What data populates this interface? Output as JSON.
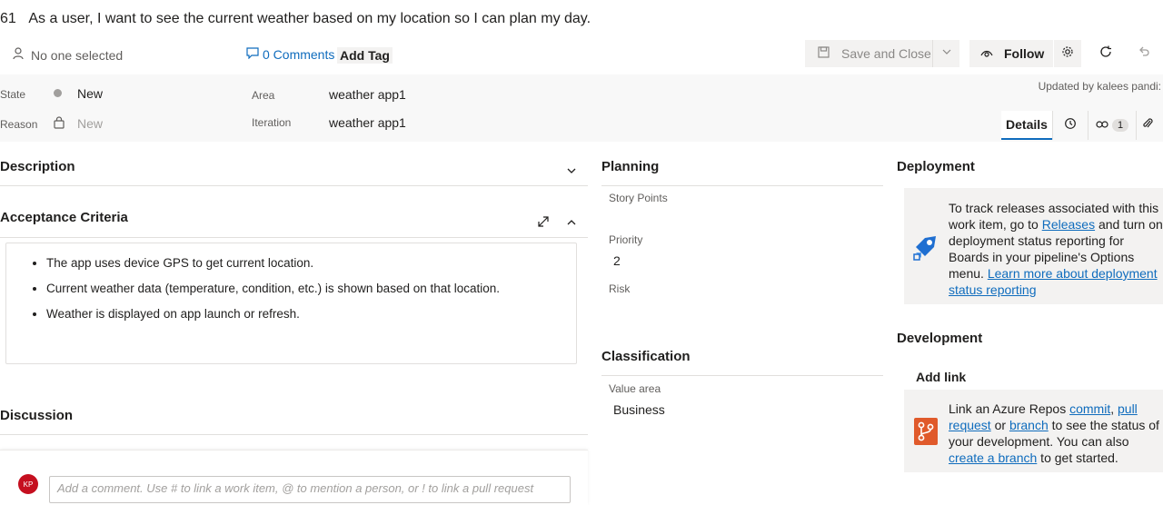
{
  "work_item": {
    "id": "61",
    "title": "As a user, I want to see the current weather based on my location so I can plan my day."
  },
  "toolbar": {
    "assignee": "No one selected",
    "comments_label": "0 Comments",
    "add_tag_label": "Add Tag",
    "save_label": "Save and Close",
    "follow_label": "Follow"
  },
  "fields": {
    "state_label": "State",
    "state_value": "New",
    "reason_label": "Reason",
    "reason_value": "New",
    "area_label": "Area",
    "area_value": "weather app1",
    "iteration_label": "Iteration",
    "iteration_value": "weather app1"
  },
  "updated_by": "Updated by kalees pandi:",
  "tabs": {
    "details_label": "Details",
    "links_count": "1"
  },
  "description": {
    "title": "Description"
  },
  "acceptance": {
    "title": "Acceptance Criteria",
    "items": [
      "The app uses device GPS to get current location.",
      "Current weather data (temperature, condition, etc.) is shown based on that location.",
      "Weather is displayed on app launch or refresh."
    ]
  },
  "discussion": {
    "title": "Discussion",
    "avatar_initials": "KP",
    "placeholder": "Add a comment. Use # to link a work item, @ to mention a person, or ! to link a pull request"
  },
  "planning": {
    "title": "Planning",
    "story_points_label": "Story Points",
    "priority_label": "Priority",
    "priority_value": "2",
    "risk_label": "Risk"
  },
  "classification": {
    "title": "Classification",
    "value_area_label": "Value area",
    "value_area_value": "Business"
  },
  "deployment": {
    "title": "Deployment",
    "text_1": "To track releases associated with this work item, go to ",
    "link_releases": "Releases",
    "text_2": " and turn on deployment status reporting for Boards in your pipeline's Options menu. ",
    "link_learn": "Learn more about deployment status reporting"
  },
  "development": {
    "title": "Development",
    "add_link_label": "Add link",
    "text_1": "Link an Azure Repos ",
    "link_commit": "commit",
    "text_2": ", ",
    "link_pull_request": "pull request",
    "text_3": " or ",
    "link_branch": "branch",
    "text_4": " to see the status of your development. You can also ",
    "link_create_branch": "create a branch",
    "text_5": " to get started."
  },
  "colors": {
    "accent": "#0f6cbd",
    "avatar": "#c50f1f",
    "state_dot": "#a19f9d"
  }
}
